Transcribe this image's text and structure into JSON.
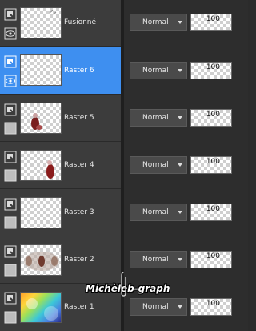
{
  "blend_mode_default": "Normal",
  "layers": [
    {
      "name": "Fusionné",
      "blend": "Normal",
      "opacity": "100",
      "visible": true,
      "selected": false
    },
    {
      "name": "Raster 6",
      "blend": "Normal",
      "opacity": "100",
      "visible": true,
      "selected": true
    },
    {
      "name": "Raster 5",
      "blend": "Normal",
      "opacity": "100",
      "visible": false,
      "selected": false
    },
    {
      "name": "Raster 4",
      "blend": "Normal",
      "opacity": "100",
      "visible": false,
      "selected": false
    },
    {
      "name": "Raster 3",
      "blend": "Normal",
      "opacity": "100",
      "visible": false,
      "selected": false
    },
    {
      "name": "Raster 2",
      "blend": "Normal",
      "opacity": "100",
      "visible": false,
      "selected": false
    },
    {
      "name": "Raster 1",
      "blend": "Normal",
      "opacity": "100",
      "visible": false,
      "selected": false
    }
  ],
  "watermark": "Michèleb-graph",
  "colors": {
    "selected": "#3e8ff0",
    "panel": "#3c3c3c",
    "right_panel": "#2d2d2d"
  }
}
